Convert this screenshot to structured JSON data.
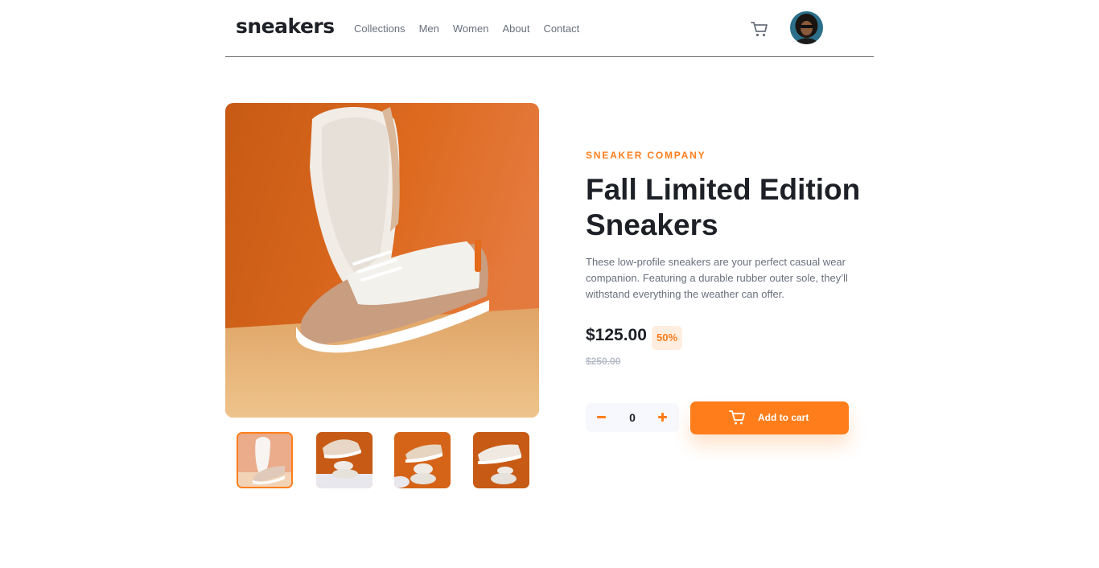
{
  "header": {
    "logo": "sneakers",
    "nav": [
      "Collections",
      "Men",
      "Women",
      "About",
      "Contact"
    ]
  },
  "gallery": {
    "thumbnails": [
      "thumbnail-1",
      "thumbnail-2",
      "thumbnail-3",
      "thumbnail-4"
    ],
    "active_index": 0
  },
  "product": {
    "company": "SNEAKER COMPANY",
    "title_line1": "Fall Limited Edition",
    "title_line2": "Sneakers",
    "description": "These low-profile sneakers are your perfect casual wear companion. Featuring a durable rubber outer sole, they’ll withstand everything the weather can offer.",
    "price": "$125.00",
    "discount": "50%",
    "original_price": "$250.00"
  },
  "cart": {
    "quantity": "0",
    "add_label": "Add to cart"
  },
  "colors": {
    "accent": "#ff7e1b",
    "accent_pale": "#ffede0",
    "text_dark": "#1d2026",
    "text_muted": "#69707d",
    "text_light": "#b6bcc8"
  },
  "icons": [
    "cart-icon",
    "avatar",
    "minus-icon",
    "plus-icon"
  ]
}
